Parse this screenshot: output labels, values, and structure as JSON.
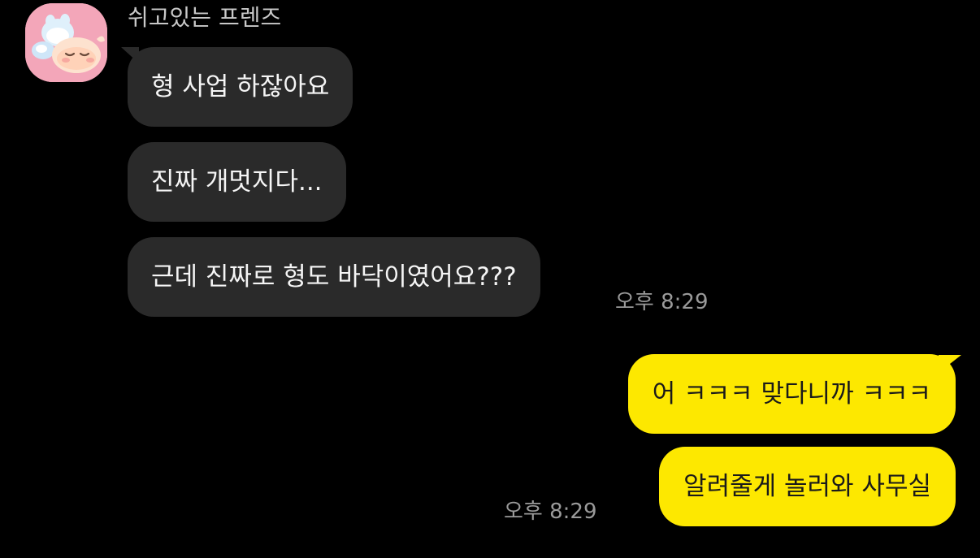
{
  "colors": {
    "background": "#000000",
    "received_bubble": "#2a2a2a",
    "sent_bubble": "#fde800",
    "sender_name": "#c9c9c9",
    "timestamp": "#9a9a9a"
  },
  "sender": {
    "name": "쉬고있는 프렌즈",
    "avatar_icon": "sleeping-peach-character-icon"
  },
  "received_messages": [
    {
      "text": "형 사업 하잖아요"
    },
    {
      "text": "진짜 개멋지다..."
    },
    {
      "text": "근데 진짜로 형도 바닥이였어요???",
      "time": "오후 8:29"
    }
  ],
  "sent_messages": [
    {
      "text": "어 ㅋㅋㅋ 맞다니까 ㅋㅋㅋ"
    },
    {
      "text": "알려줄게 놀러와 사무실",
      "time": "오후 8:29"
    }
  ]
}
